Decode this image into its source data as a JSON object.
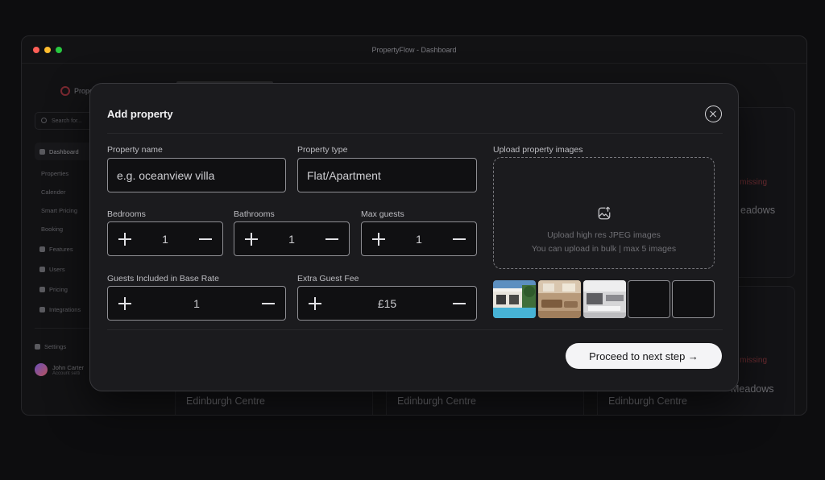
{
  "window": {
    "title": "PropertyFlow - Dashboard",
    "traffic_lights": [
      "#ff5f57",
      "#febc2e",
      "#28c840"
    ]
  },
  "sidebar": {
    "brand": "Prope",
    "search_placeholder": "Search for...",
    "items": [
      {
        "label": "Dashboard"
      },
      {
        "label": "Properties"
      },
      {
        "label": "Calender"
      },
      {
        "label": "Smart Pricing"
      },
      {
        "label": "Booking"
      },
      {
        "label": "Features"
      },
      {
        "label": "Users"
      },
      {
        "label": "Pricing"
      },
      {
        "label": "Integrations"
      },
      {
        "label": "Settings"
      }
    ],
    "user": {
      "name": "John Carter",
      "subtitle": "Account setti"
    }
  },
  "background_cards": {
    "partial_text_1": "nt missing",
    "partial_text_2": "eadows",
    "partial_text_3": "nt missing",
    "partial_text_4": "Meadows",
    "card_location_1": "Edinburgh Centre",
    "card_location_2": "Edinburgh Centre",
    "card_location_3": "Edinburgh Centre"
  },
  "modal": {
    "title": "Add property",
    "property_name": {
      "label": "Property name",
      "placeholder": "e.g. oceanview villa"
    },
    "property_type": {
      "label": "Property type",
      "value": "Flat/Apartment"
    },
    "bedrooms": {
      "label": "Bedrooms",
      "value": "1"
    },
    "bathrooms": {
      "label": "Bathrooms",
      "value": "1"
    },
    "max_guests": {
      "label": "Max guests",
      "value": "1"
    },
    "guests_included": {
      "label": "Guests Included in Base Rate",
      "value": "1"
    },
    "extra_guest_fee": {
      "label": "Extra Guest Fee",
      "value": "£15"
    },
    "upload": {
      "label": "Upload property images",
      "line1": "Upload high res JPEG images",
      "line2": "You can upload in bulk | max 5 images",
      "thumbnails": [
        "filled",
        "filled",
        "filled",
        "empty",
        "empty"
      ]
    },
    "proceed_label": "Proceed to next step →"
  }
}
